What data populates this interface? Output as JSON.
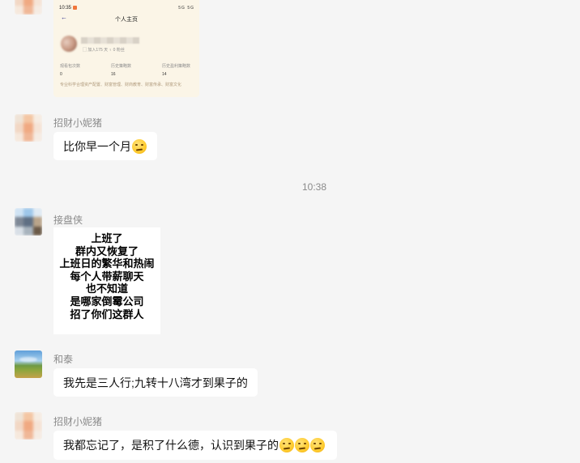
{
  "screenshot_card": {
    "status_time": "10:35",
    "status_right": "5G 5G",
    "back_icon": "back-arrow-icon",
    "title": "个人主页",
    "meta": "▢ 加入175 天   ♀ 0 粉丝",
    "stats": [
      {
        "label": "观看包次数",
        "value": "0"
      },
      {
        "label": "历史策略数",
        "value": "16"
      },
      {
        "label": "历史盈利策略数",
        "value": "14"
      }
    ],
    "tags": "专业科学合理资产配置、财富管理、财商教育、财富传承、财富文化"
  },
  "messages": {
    "m1": {
      "sender": "招财小妮猪",
      "text": "比你早一个月",
      "emoji_count": 1
    },
    "timestamp": "10:38",
    "m2": {
      "sender": "接盘侠",
      "image_lines": [
        "上班了",
        "群内又恢复了",
        "上班日的繁华和热闹",
        "每个人带薪聊天",
        "也不知道",
        "是哪家倒霉公司",
        "招了你们这群人"
      ]
    },
    "m3": {
      "sender": "和泰",
      "text": "我先是三人行;九转十八湾才到果子的"
    },
    "m4": {
      "sender": "招财小妮猪",
      "text": "我都忘记了，是积了什么德，认识到果子的",
      "emoji_count": 3
    }
  },
  "icons": {
    "emoji": "thinking-face-emoji-icon"
  }
}
